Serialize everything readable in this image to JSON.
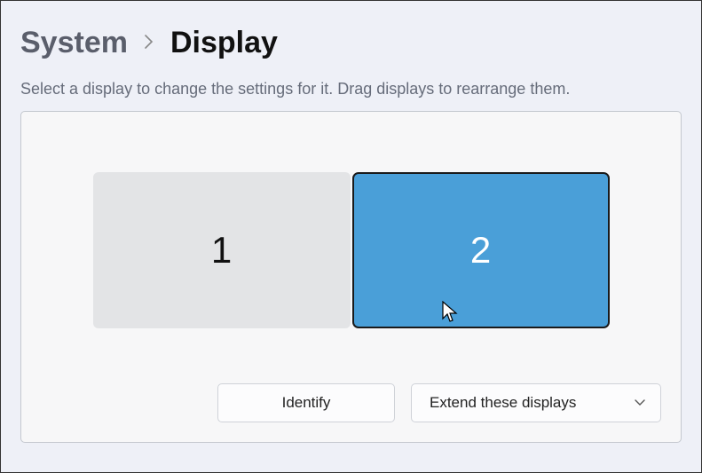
{
  "breadcrumb": {
    "parent": "System",
    "current": "Display"
  },
  "description": "Select a display to change the settings for it. Drag displays to rearrange them.",
  "monitors": {
    "display1_label": "1",
    "display2_label": "2"
  },
  "controls": {
    "identify_label": "Identify",
    "mode_label": "Extend these displays"
  }
}
